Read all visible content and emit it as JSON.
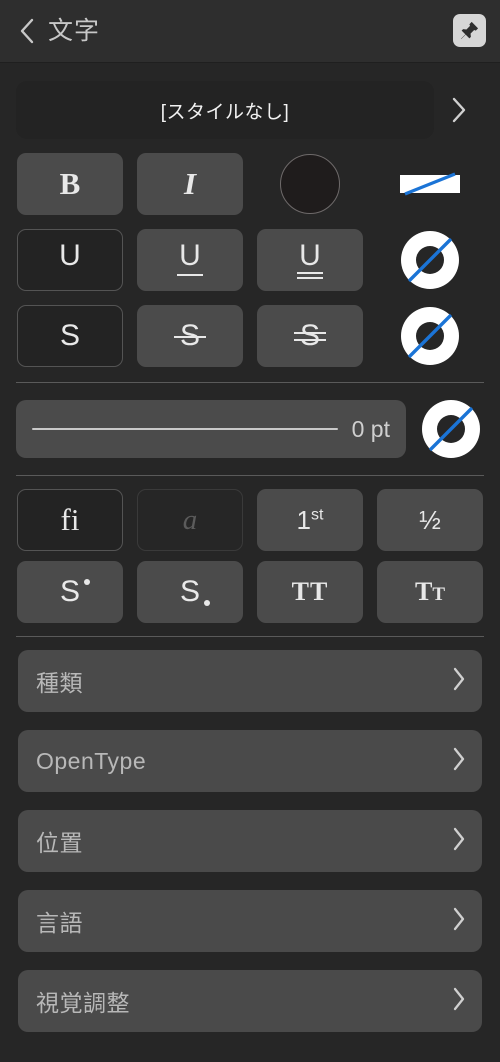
{
  "header": {
    "title": "文字",
    "back_icon": "chevron-left-icon",
    "pin_icon": "pin-icon"
  },
  "style_row": {
    "label": "[スタイルなし]",
    "chevron_icon": "chevron-right-icon"
  },
  "format_rows": [
    {
      "name": "bold-italic-row",
      "buttons": [
        {
          "name": "bold-button",
          "glyph": "B",
          "kind": "bold",
          "state": "normal"
        },
        {
          "name": "italic-button",
          "glyph": "I",
          "kind": "italic",
          "state": "normal"
        }
      ],
      "swatch": {
        "name": "text-color-swatch",
        "color": "#1f1c1c",
        "border": "#6e6a6a"
      },
      "indicator": {
        "name": "no-fill-bar-icon",
        "shape": "bar",
        "fill": "#ffffff",
        "slash": "#1b74d6"
      }
    },
    {
      "name": "underline-row",
      "buttons": [
        {
          "name": "underline-none-button",
          "glyph": "U",
          "kind": "u-none",
          "state": "selected"
        },
        {
          "name": "underline-single-button",
          "glyph": "U",
          "kind": "u-single",
          "state": "normal"
        },
        {
          "name": "underline-double-button",
          "glyph": "U",
          "kind": "u-double",
          "state": "normal"
        }
      ],
      "indicator": {
        "name": "underline-color-donut-icon",
        "shape": "donut",
        "fill": "#ffffff",
        "slash": "#1b74d6"
      }
    },
    {
      "name": "strikethrough-row",
      "buttons": [
        {
          "name": "strikethrough-none-button",
          "glyph": "S",
          "kind": "s-none",
          "state": "selected"
        },
        {
          "name": "strikethrough-single-button",
          "glyph": "S",
          "kind": "s-single",
          "state": "normal"
        },
        {
          "name": "strikethrough-double-button",
          "glyph": "S",
          "kind": "s-double",
          "state": "normal"
        }
      ],
      "indicator": {
        "name": "strikethrough-color-donut-icon",
        "shape": "donut",
        "fill": "#ffffff",
        "slash": "#1b74d6"
      }
    }
  ],
  "slider": {
    "name": "outline-width-slider",
    "value": "0 pt",
    "indicator": {
      "name": "outline-color-donut-icon",
      "shape": "donut",
      "fill": "#ffffff",
      "slash": "#1b74d6"
    }
  },
  "typography_rows": [
    {
      "name": "ligature-row",
      "buttons": [
        {
          "name": "ligature-button",
          "glyph": "fi",
          "kind": "ligature",
          "state": "selected"
        },
        {
          "name": "swash-button",
          "glyph": "a",
          "kind": "swash",
          "state": "disabled"
        },
        {
          "name": "ordinals-button",
          "glyph": "1st",
          "kind": "ordinal",
          "state": "normal"
        },
        {
          "name": "fractions-button",
          "glyph": "½",
          "kind": "fraction",
          "state": "normal"
        }
      ]
    },
    {
      "name": "script-caps-row",
      "buttons": [
        {
          "name": "superscript-button",
          "glyph": "S",
          "kind": "superscript",
          "state": "normal"
        },
        {
          "name": "subscript-button",
          "glyph": "S",
          "kind": "subscript",
          "state": "normal"
        },
        {
          "name": "all-caps-button",
          "glyph": "TT",
          "kind": "allcaps",
          "state": "normal"
        },
        {
          "name": "small-caps-button",
          "glyph": "TT",
          "kind": "smallcaps",
          "state": "normal"
        }
      ]
    }
  ],
  "list_rows": [
    {
      "name": "list-row-type",
      "label": "種類",
      "chevron_icon": "chevron-right-icon"
    },
    {
      "name": "list-row-opentype",
      "label": "OpenType",
      "chevron_icon": "chevron-right-icon"
    },
    {
      "name": "list-row-position",
      "label": "位置",
      "chevron_icon": "chevron-right-icon"
    },
    {
      "name": "list-row-language",
      "label": "言語",
      "chevron_icon": "chevron-right-icon"
    },
    {
      "name": "list-row-optical",
      "label": "視覚調整",
      "chevron_icon": "chevron-right-icon"
    }
  ],
  "colors": {
    "background": "#262626",
    "header_bg": "#2e2e2e",
    "button_bg": "#4b4b4b",
    "button_selected_bg": "#232323",
    "accent_blue": "#1b74d6",
    "text": "#e8e8e8",
    "muted_text": "#b8b8b8"
  }
}
